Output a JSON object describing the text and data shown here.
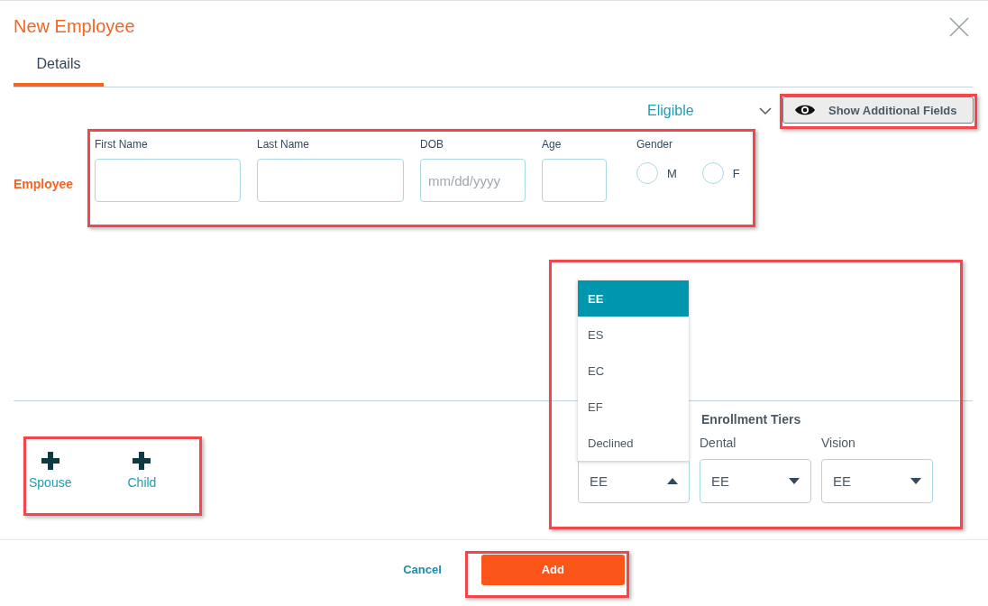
{
  "dialog": {
    "title": "New Employee"
  },
  "tabs": [
    {
      "label": "Details",
      "selected": true
    }
  ],
  "eligibility": {
    "value": "Eligible"
  },
  "show_fields_button": {
    "label": "Show Additional Fields"
  },
  "employee": {
    "label": "Employee",
    "fields": [
      {
        "label": "First Name"
      },
      {
        "label": "Last Name"
      },
      {
        "label": "DOB",
        "placeholder": "mm/dd/yyyy"
      },
      {
        "label": "Age"
      }
    ],
    "gender": {
      "label": "Gender",
      "options": [
        {
          "label": "M",
          "selected": false
        },
        {
          "label": "F",
          "selected": false
        }
      ]
    }
  },
  "dependents": [
    {
      "label": "Spouse"
    },
    {
      "label": "Child"
    }
  ],
  "enrollment_tiers": {
    "title": "Enrollment Tiers",
    "selects": [
      {
        "value": "EE",
        "expanded": true
      },
      {
        "label": "Dental",
        "value": "EE",
        "expanded": false
      },
      {
        "label": "Vision",
        "value": "EE",
        "expanded": false
      }
    ]
  },
  "tier_menu": {
    "options": [
      {
        "label": "EE",
        "selected": true
      },
      {
        "label": "ES",
        "selected": false
      },
      {
        "label": "EC",
        "selected": false
      },
      {
        "label": "EF",
        "selected": false
      },
      {
        "label": "Declined",
        "selected": false
      }
    ]
  },
  "footer": {
    "cancel": "Cancel",
    "add": "Add"
  }
}
